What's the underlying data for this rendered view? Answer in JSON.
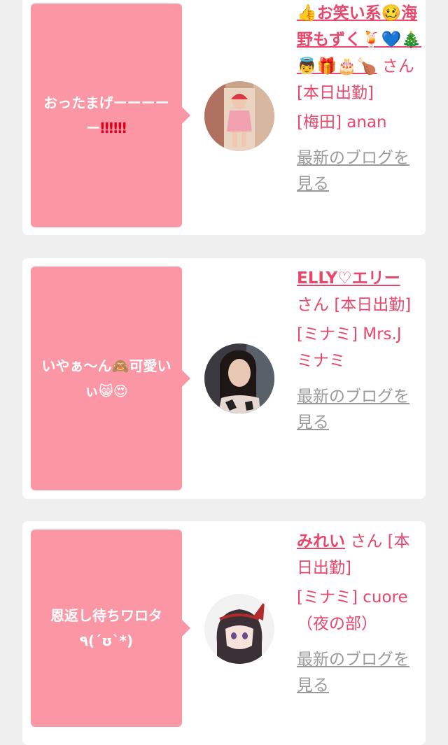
{
  "entries": [
    {
      "message_text": "おったまげーーーーー",
      "message_suffix": "‼‼‼",
      "name_text": "👍お笑い系🥴海野もずく🍹💙🎄👼🎁🎂🍗",
      "san": "さん",
      "status": "[本日出勤]",
      "shop": "[梅田] anan",
      "blog_link": "最新のブログを見る"
    },
    {
      "message_text": "いやぁ〜ん🙈可愛いぃ😸😍",
      "message_suffix": "",
      "name_text": "ELLY♡エリー",
      "san": "さん",
      "status": "[本日出勤]",
      "shop": "[ミナミ] Mrs.J ミナミ",
      "blog_link": "最新のブログを見る"
    },
    {
      "message_text": "恩返し待ちワロタ ٩(´ʊ`*)",
      "message_suffix": "",
      "name_text": "みれい",
      "san": "さん",
      "status": "[本日出勤]",
      "shop": "[ミナミ] cuore（夜の部）",
      "blog_link": "最新のブログを見る"
    }
  ]
}
